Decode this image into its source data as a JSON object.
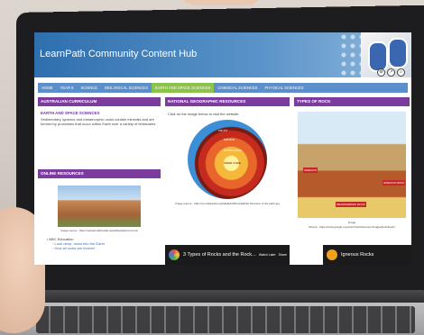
{
  "page": {
    "title": "LearnPath Community Content Hub"
  },
  "nav": {
    "items": [
      {
        "label": "HOME"
      },
      {
        "label": "YEAR 8"
      },
      {
        "label": "SCIENCE"
      },
      {
        "label": "BIOLOGICAL SCIENCES"
      },
      {
        "label": "EARTH AND SPACE SCIENCES",
        "active": true
      },
      {
        "label": "CHEMICAL SCIENCES"
      },
      {
        "label": "PHYSICAL SCIENCES"
      }
    ]
  },
  "left": {
    "curriculum_header": "AUSTRALIAN CURRICULUM",
    "curriculum_link": "EARTH AND SPACE SCIENCES",
    "curriculum_text": "Sedimentary, igneous and metamorphic rocks contain minerals and are formed by processes that occur within Earth over a variety of timescales",
    "online_header": "ONLINE RESOURCES",
    "image_caption": "Image source - https://upload.wikimedia.org/wikipedia/commons/",
    "list_items": [
      "ABC Education",
      "Look deep, down into the Earth",
      "How all rocks are formed"
    ]
  },
  "middle": {
    "header": "NATIONAL GEOGRAPHIC RESOURCES",
    "intro": "Click on the image below to visit the website.",
    "image_caption": "Image source - https://en.wikipedia.org/wiki/Earth#/media/File:Structure of the earth.jpg",
    "earth_labels": [
      "CRUST",
      "MANTLE",
      "OUTER CORE",
      "INNER CORE"
    ]
  },
  "right": {
    "header": "TYPES OF ROCK",
    "caption_line1": "Image",
    "caption_line2": "Source - https://www.google.org.au/url?sa=i&source=images&cd=&ved=",
    "labels": [
      "IGNEOUS",
      "IGNEOUS ROCK",
      "METAMORPHIC ROCK"
    ]
  },
  "videos": [
    {
      "title": "3 Types of Rocks and the Rock...",
      "watch_later": "Watch Later",
      "share": "Share"
    },
    {
      "title": "Igneous Rocks"
    }
  ],
  "colors": {
    "hero": "#2f6fae",
    "nav": "#5b8fcb",
    "nav_active": "#8bc34a",
    "panel_header": "#7b3c9e"
  }
}
